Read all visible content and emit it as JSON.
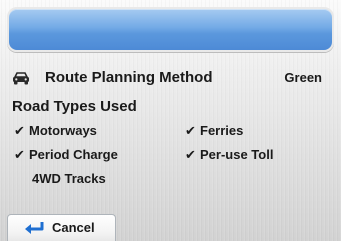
{
  "colors": {
    "title_bar": "#5b98dd",
    "text": "#1a1a1a",
    "back_arrow": "#1f6fd1"
  },
  "route": {
    "icon": "car-icon",
    "label": "Route Planning Method",
    "value": "Green"
  },
  "road_types": {
    "title": "Road Types Used",
    "options": [
      {
        "label": "Motorways",
        "checked": true
      },
      {
        "label": "Ferries",
        "checked": true
      },
      {
        "label": "Period Charge",
        "checked": true
      },
      {
        "label": "Per-use Toll",
        "checked": true
      },
      {
        "label": "4WD Tracks",
        "checked": false
      }
    ],
    "check_glyph": "✔"
  },
  "footer": {
    "cancel_icon": "back-arrow-icon",
    "cancel_label": "Cancel"
  }
}
